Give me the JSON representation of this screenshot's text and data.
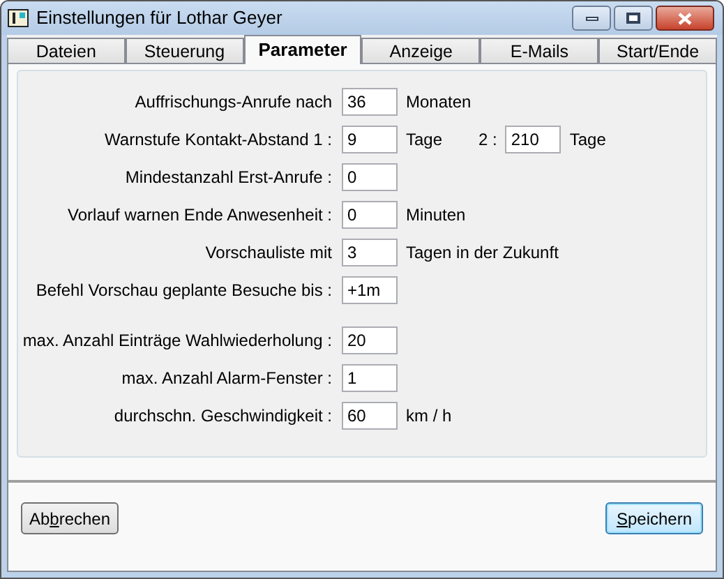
{
  "window": {
    "title": "Einstellungen für Lothar Geyer"
  },
  "tabs": [
    {
      "label": "Dateien",
      "selected": false
    },
    {
      "label": "Steuerung",
      "selected": false
    },
    {
      "label": "Parameter",
      "selected": true
    },
    {
      "label": "Anzeige",
      "selected": false
    },
    {
      "label": "E-Mails",
      "selected": false
    },
    {
      "label": "Start/Ende",
      "selected": false
    }
  ],
  "sections": [
    {
      "rows": [
        {
          "label": "Auffrischungs-Anrufe nach",
          "value": "36",
          "unit": "Monaten"
        },
        {
          "label": "Warnstufe Kontakt-Abstand 1 :",
          "value": "9",
          "unit": "Tage",
          "extra": {
            "label": "2 :",
            "value": "210",
            "unit": "Tage"
          }
        },
        {
          "label": "Mindestanzahl Erst-Anrufe :",
          "value": "0"
        },
        {
          "label": "Vorlauf warnen Ende Anwesenheit :",
          "value": "0",
          "unit": "Minuten"
        },
        {
          "label": "Vorschauliste mit",
          "value": "3",
          "unit": "Tagen in der Zukunft"
        },
        {
          "label": "Befehl Vorschau geplante Besuche bis :",
          "value": "+1m"
        }
      ]
    },
    {
      "rows": [
        {
          "label": "max. Anzahl Einträge Wahlwiederholung :",
          "value": "20"
        },
        {
          "label": "max. Anzahl Alarm-Fenster :",
          "value": "1"
        },
        {
          "label": "durchschn. Geschwindigkeit :",
          "value": "60",
          "unit": "km / h"
        }
      ]
    }
  ],
  "buttons": [
    {
      "before": "Ab",
      "accesskey": "b",
      "after": "rechen",
      "default": false
    },
    {
      "accesskey": "S",
      "after": "peichern",
      "default": true
    }
  ]
}
